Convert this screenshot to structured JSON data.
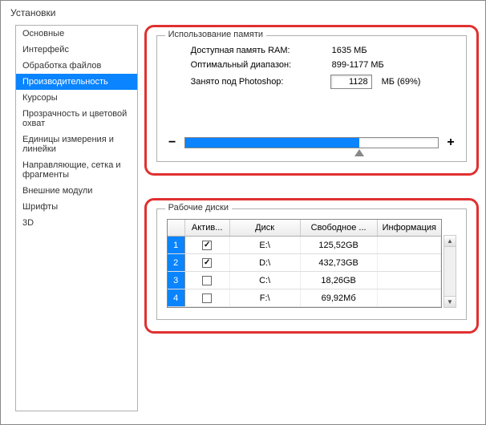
{
  "window": {
    "title": "Установки"
  },
  "sidebar": {
    "items": [
      {
        "label": "Основные"
      },
      {
        "label": "Интерфейс"
      },
      {
        "label": "Обработка файлов"
      },
      {
        "label": "Производительность"
      },
      {
        "label": "Курсоры"
      },
      {
        "label": "Прозрачность и цветовой охват"
      },
      {
        "label": "Единицы измерения и линейки"
      },
      {
        "label": "Направляющие, сетка и фрагменты"
      },
      {
        "label": "Внешние модули"
      },
      {
        "label": "Шрифты"
      },
      {
        "label": "3D"
      }
    ],
    "selected_index": 3
  },
  "memory": {
    "legend": "Использование памяти",
    "available_label": "Доступная память RAM:",
    "available_value": "1635 МБ",
    "range_label": "Оптимальный диапазон:",
    "range_value": "899-1177 МБ",
    "used_label": "Занято под Photoshop:",
    "used_input": "1128",
    "used_suffix": "МБ (69%)",
    "minus": "−",
    "plus": "+",
    "slider_percent": 69
  },
  "disks": {
    "legend": "Рабочие диски",
    "headers": {
      "active": "Актив...",
      "disk": "Диск",
      "free": "Свободное ...",
      "info": "Информация"
    },
    "rows": [
      {
        "idx": "1",
        "active": true,
        "disk": "E:\\",
        "free": "125,52GB",
        "info": ""
      },
      {
        "idx": "2",
        "active": true,
        "disk": "D:\\",
        "free": "432,73GB",
        "info": ""
      },
      {
        "idx": "3",
        "active": false,
        "disk": "C:\\",
        "free": "18,26GB",
        "info": ""
      },
      {
        "idx": "4",
        "active": false,
        "disk": "F:\\",
        "free": "69,92Мб",
        "info": ""
      }
    ]
  }
}
